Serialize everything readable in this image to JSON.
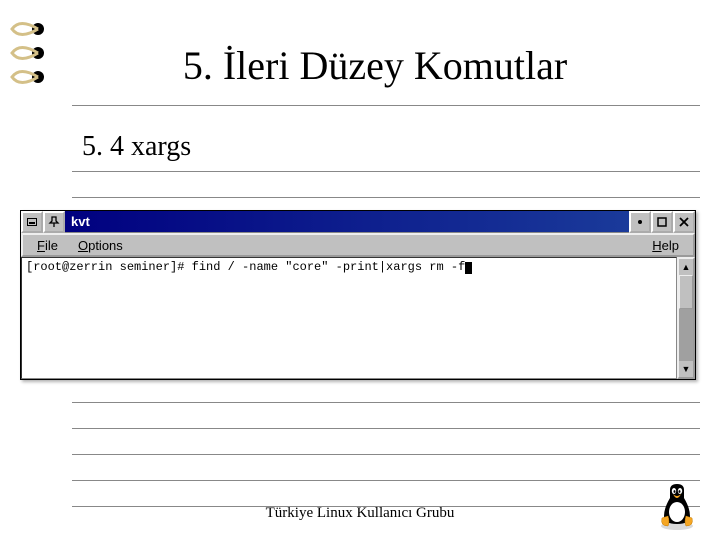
{
  "title": "5. İleri Düzey Komutlar",
  "subtitle": "5. 4 xargs",
  "window": {
    "title": "kvt",
    "menus": {
      "file": "File",
      "options": "Options",
      "help": "Help"
    },
    "terminal_line": "[root@zerrin seminer]# find / -name \"core\" -print|xargs rm -f"
  },
  "footer": "Türkiye Linux Kullanıcı Grubu"
}
